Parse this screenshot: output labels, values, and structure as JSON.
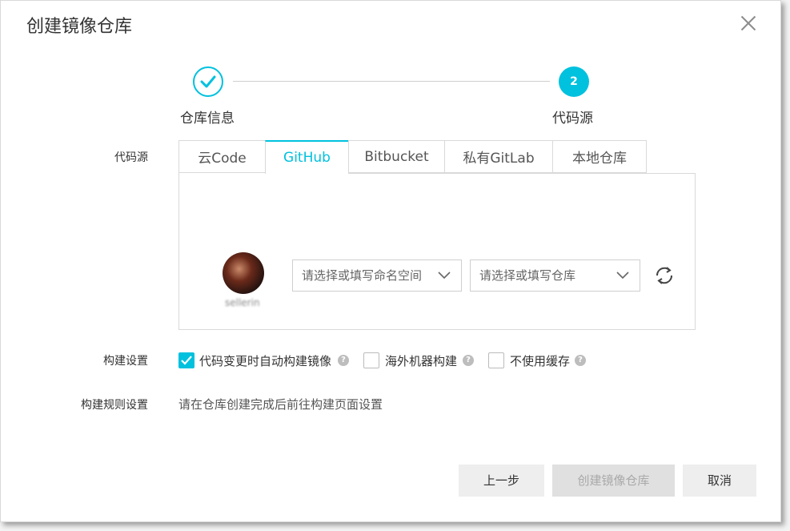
{
  "dialog": {
    "title": "创建镜像仓库"
  },
  "steps": [
    {
      "label": "仓库信息",
      "state": "done"
    },
    {
      "label": "代码源",
      "number": "2",
      "state": "active"
    }
  ],
  "code_source": {
    "label": "代码源",
    "tabs": [
      {
        "label": "云Code",
        "active": false
      },
      {
        "label": "GitHub",
        "active": true
      },
      {
        "label": "Bitbucket",
        "active": false
      },
      {
        "label": "私有GitLab",
        "active": false
      },
      {
        "label": "本地仓库",
        "active": false
      }
    ],
    "account_name": "sellerin",
    "namespace_select": {
      "placeholder": "请选择或填写命名空间"
    },
    "repo_select": {
      "placeholder": "请选择或填写仓库"
    }
  },
  "build_settings": {
    "label": "构建设置",
    "options": [
      {
        "label": "代码变更时自动构建镜像",
        "checked": true
      },
      {
        "label": "海外机器构建",
        "checked": false
      },
      {
        "label": "不使用缓存",
        "checked": false
      }
    ],
    "help_glyph": "?"
  },
  "build_rules": {
    "label": "构建规则设置",
    "text": "请在仓库创建完成后前往构建页面设置"
  },
  "buttons": {
    "prev": "上一步",
    "create": "创建镜像仓库",
    "cancel": "取消"
  },
  "colors": {
    "accent": "#00c1de",
    "disabled_bg": "#e0e0e0",
    "disabled_text": "#a9a9a9"
  }
}
